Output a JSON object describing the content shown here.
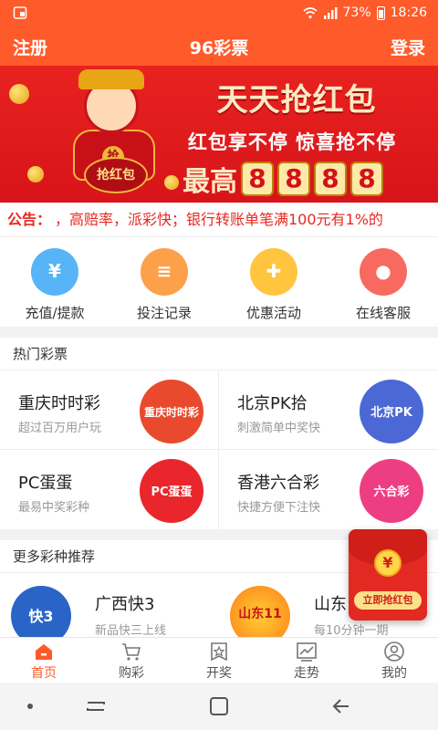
{
  "status_bar": {
    "battery": "73%",
    "time": "18:26"
  },
  "header": {
    "left_label": "注册",
    "title": "96彩票",
    "right_label": "登录"
  },
  "banner": {
    "badge_on_god": "抢",
    "bag_label": "抢红包",
    "title": "天天抢红包",
    "subtitle": "红包享不停 惊喜抢不停",
    "max_label": "最高",
    "max_amount": [
      "8",
      "8",
      "8",
      "8"
    ]
  },
  "notice": {
    "label": "公告：",
    "text": "，高赔率，派彩快；银行转账单笔满100元有1%的"
  },
  "quick_actions": [
    {
      "label": "充值/提款",
      "icon": "money-bag-icon",
      "glyph": "¥"
    },
    {
      "label": "投注记录",
      "icon": "record-icon",
      "glyph": "≡"
    },
    {
      "label": "优惠活动",
      "icon": "gift-icon",
      "glyph": "✚"
    },
    {
      "label": "在线客服",
      "icon": "customer-service-icon",
      "glyph": "●"
    }
  ],
  "hot_section": {
    "title": "热门彩票",
    "items": [
      {
        "name": "重庆时时彩",
        "desc": "超过百万用户玩",
        "logo_text": "重庆时时彩"
      },
      {
        "name": "北京PK拾",
        "desc": "刺激简单中奖快",
        "logo_text": "北京PK"
      },
      {
        "name": "PC蛋蛋",
        "desc": "最易中奖彩种",
        "logo_text": "PC蛋蛋"
      },
      {
        "name": "香港六合彩",
        "desc": "快捷方便下注快",
        "logo_text": "六合彩"
      }
    ]
  },
  "more_section": {
    "title": "更多彩种推荐",
    "items": [
      {
        "name": "广西快3",
        "desc": "新品快三上线",
        "logo_text": "快3"
      },
      {
        "name": "山东",
        "desc": "每10分钟一期",
        "logo_text": "山东11"
      }
    ]
  },
  "float_packet": {
    "coin": "¥",
    "label": "立即抢红包"
  },
  "tabs": [
    {
      "label": "首页",
      "icon": "home-icon",
      "active": true
    },
    {
      "label": "购彩",
      "icon": "cart-icon",
      "active": false
    },
    {
      "label": "开奖",
      "icon": "award-icon",
      "active": false
    },
    {
      "label": "走势",
      "icon": "trend-icon",
      "active": false
    },
    {
      "label": "我的",
      "icon": "user-icon",
      "active": false
    }
  ],
  "colors": {
    "brand": "#ff5a2a",
    "banner_red": "#e8221f",
    "notice_text": "#e8271f"
  }
}
